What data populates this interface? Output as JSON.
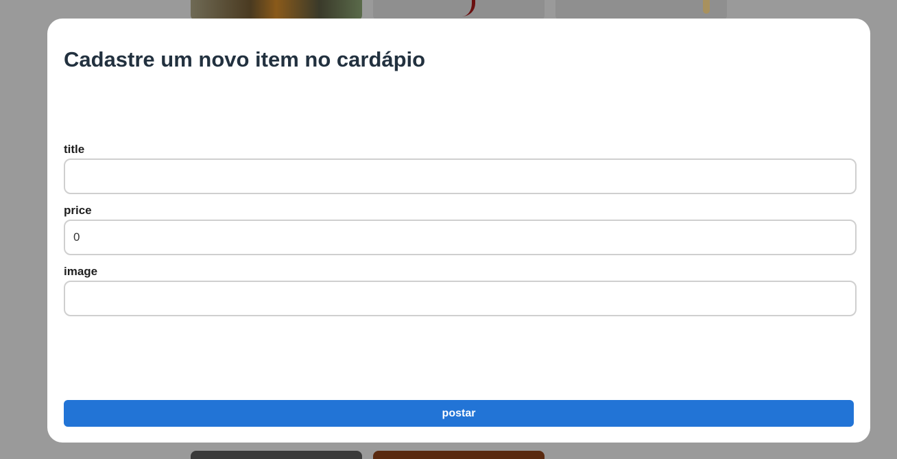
{
  "modal": {
    "title": "Cadastre um novo item no cardápio",
    "fields": [
      {
        "label": "title",
        "value": ""
      },
      {
        "label": "price",
        "value": "0"
      },
      {
        "label": "image",
        "value": ""
      }
    ],
    "submit_label": "postar"
  },
  "colors": {
    "overlay": "#9a9a9a",
    "modal_background": "#ffffff",
    "title_text": "#22313f",
    "input_border": "#cfcfcf",
    "button_background": "#2274d6",
    "button_text": "#ffffff"
  }
}
